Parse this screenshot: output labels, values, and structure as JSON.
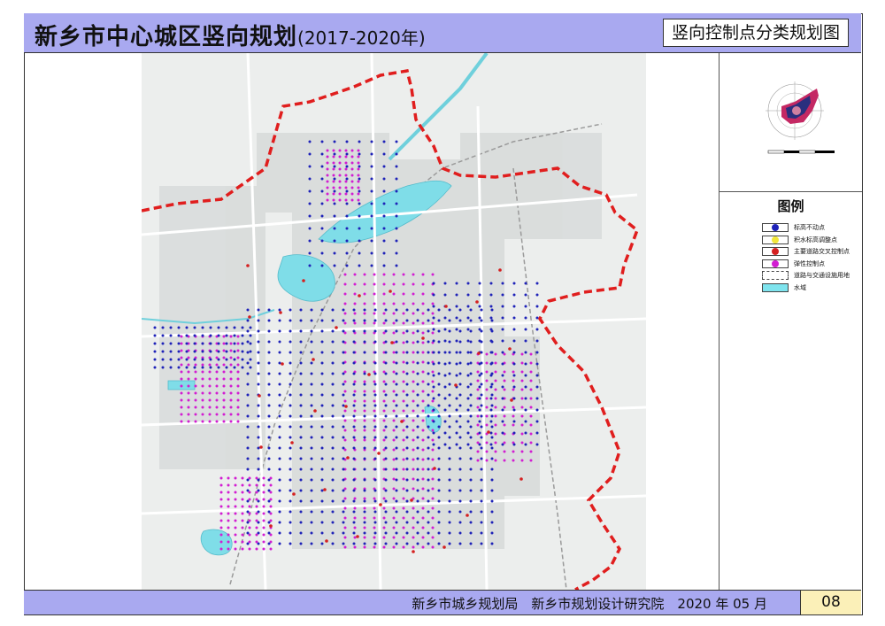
{
  "header": {
    "title": "新乡市中心城区竖向规划",
    "title_years": "(2017-2020年)",
    "map_name": "竖向控制点分类规划图"
  },
  "footer": {
    "org": "新乡市城乡规划局　新乡市规划设计研究院　2020 年 05 月",
    "page": "08"
  },
  "legend": {
    "title": "图例",
    "items": [
      {
        "label": "标高不动点",
        "color": "#1e22b8",
        "kind": "dot"
      },
      {
        "label": "积水标高调整点",
        "color": "#f2e63a",
        "kind": "dot"
      },
      {
        "label": "主要道路交叉控制点",
        "color": "#d52020",
        "kind": "dot"
      },
      {
        "label": "弹性控制点",
        "color": "#d21dd2",
        "kind": "dot"
      },
      {
        "label": "道路与交通设施用地",
        "color": "#ffffff",
        "kind": "road"
      },
      {
        "label": "水域",
        "color": "#7fe4ee",
        "kind": "fill"
      }
    ]
  },
  "colors": {
    "boundary": "#e01e1e",
    "water": "#7fdde8",
    "fixed_point": "#1e22b8",
    "flex_point": "#d21dd2",
    "intersection_point": "#d52020",
    "header_bg": "#a9a9f0"
  }
}
